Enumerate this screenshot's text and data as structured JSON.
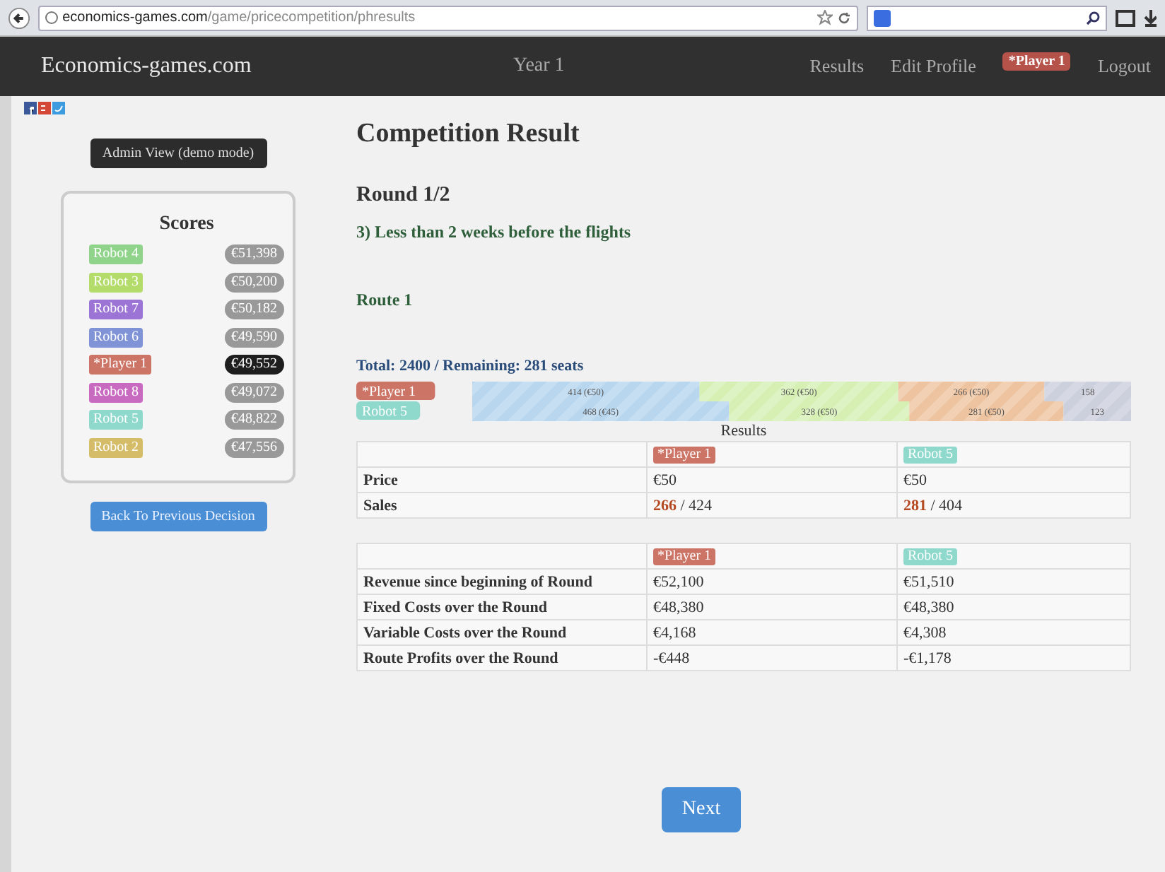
{
  "browser": {
    "url_host": "economics-games.com",
    "url_path": "/game/pricecompetition/phresults"
  },
  "navbar": {
    "brand": "Economics-games.com",
    "center": "Year 1",
    "links": [
      "Results",
      "Edit Profile"
    ],
    "player_badge": "*Player 1",
    "logout": "Logout"
  },
  "sidebar": {
    "admin_button": "Admin View (demo mode)",
    "scores_title": "Scores",
    "back_button": "Back To Previous Decision",
    "scores": [
      {
        "name": "Robot 4",
        "value": "€51,398",
        "color": "#8fd48a",
        "current": false
      },
      {
        "name": "Robot 3",
        "value": "€50,200",
        "color": "#b4dc6a",
        "current": false
      },
      {
        "name": "Robot 7",
        "value": "€50,182",
        "color": "#9b74d6",
        "current": false
      },
      {
        "name": "Robot 6",
        "value": "€49,590",
        "color": "#7f93d6",
        "current": false
      },
      {
        "name": "*Player 1",
        "value": "€49,552",
        "color": "#cc7466",
        "current": true
      },
      {
        "name": "Robot 8",
        "value": "€49,072",
        "color": "#c86ac0",
        "current": false
      },
      {
        "name": "Robot 5",
        "value": "€48,822",
        "color": "#8fd8cc",
        "current": false
      },
      {
        "name": "Robot 2",
        "value": "€47,556",
        "color": "#d4bc68",
        "current": false
      }
    ]
  },
  "main": {
    "title": "Competition Result",
    "round": "Round 1/2",
    "period": "3) Less than 2 weeks before the flights",
    "route": "Route 1",
    "total": "Total: 2400 / Remaining: 281 seats",
    "seat_chart": {
      "category_tags": [
        {
          "color": "#cc7466"
        },
        {
          "color": "#8fd8cc"
        }
      ],
      "chart_data": {
        "type": "bar",
        "orientation": "horizontal",
        "stacked": true,
        "categories": [
          "*Player 1",
          "Robot 5"
        ],
        "series": [
          {
            "color": "#b8d6ee",
            "values": [
              414,
              468
            ],
            "value_labels": [
              "414 (€50)",
              "468 (€45)"
            ]
          },
          {
            "color": "#d6f0b4",
            "values": [
              362,
              328
            ],
            "value_labels": [
              "362 (€50)",
              "328 (€50)"
            ]
          },
          {
            "color": "#eec4a0",
            "values": [
              266,
              281
            ],
            "value_labels": [
              "266 (€50)",
              "281 (€50)"
            ]
          },
          {
            "color": "#ccd0dc",
            "values": [
              158,
              123
            ],
            "value_labels": [
              "158",
              "123"
            ]
          }
        ]
      }
    },
    "results_caption": "Results",
    "tables": [
      {
        "columns": [
          {
            "label": "*Player 1",
            "color": "#cc7466"
          },
          {
            "label": "Robot 5",
            "color": "#8fd8cc"
          }
        ],
        "rows": [
          {
            "label": "Price",
            "cells": [
              "€50",
              "€50"
            ]
          },
          {
            "label": "Sales",
            "cells": [
              "**266** / 424",
              "**281** / 404"
            ]
          }
        ]
      },
      {
        "columns": [
          {
            "label": "*Player 1",
            "color": "#cc7466"
          },
          {
            "label": "Robot 5",
            "color": "#8fd8cc"
          }
        ],
        "rows": [
          {
            "label": "Revenue since beginning of Round",
            "cells": [
              "€52,100",
              "€51,510"
            ]
          },
          {
            "label": "Fixed Costs over the Round",
            "cells": [
              "€48,380",
              "€48,380"
            ]
          },
          {
            "label": "Variable Costs over the Round",
            "cells": [
              "€4,168",
              "€4,308"
            ]
          },
          {
            "label": "Route Profits over the Round",
            "cells": [
              "-€448",
              "-€1,178"
            ]
          }
        ]
      }
    ],
    "next_button": "Next"
  }
}
